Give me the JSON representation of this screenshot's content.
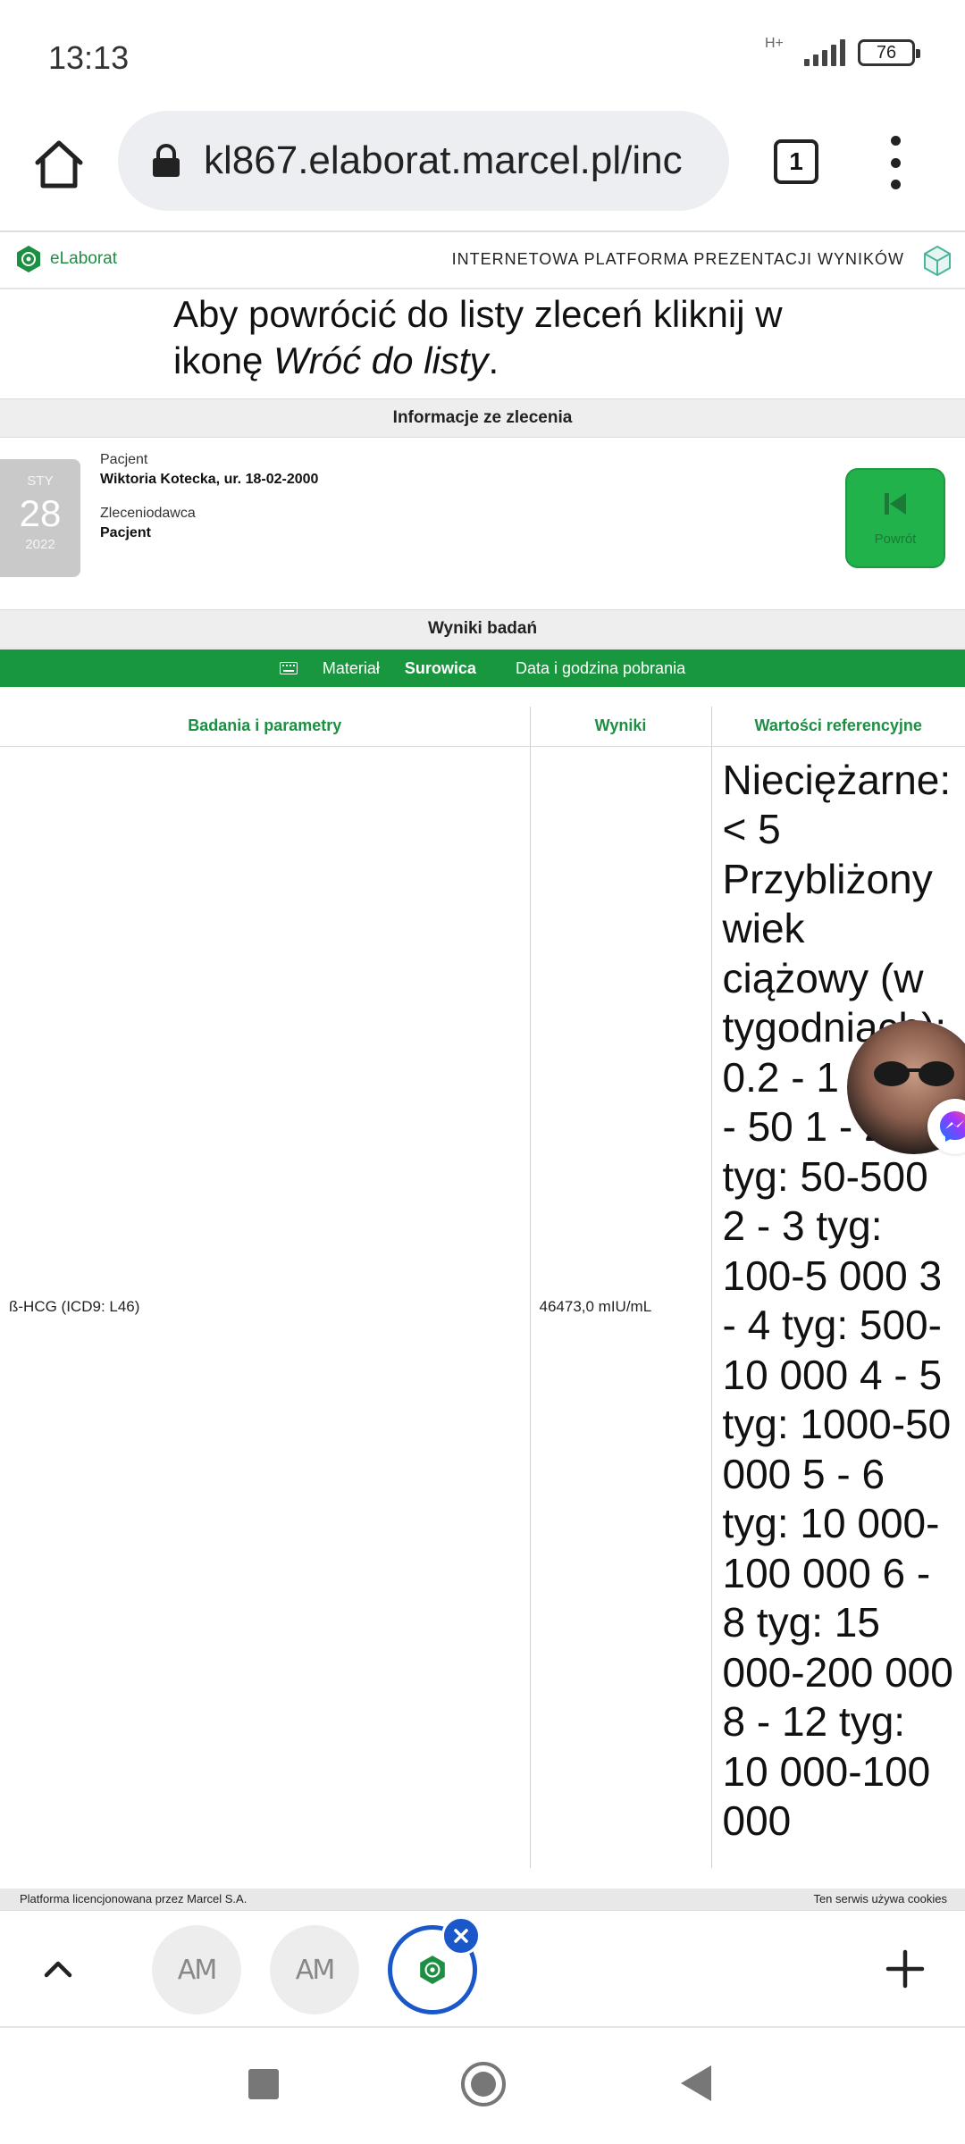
{
  "status_bar": {
    "time": "13:13",
    "network_type": "H+",
    "battery_level": "76"
  },
  "browser": {
    "url": "kl867.elaborat.marcel.pl/inc",
    "tab_count": "1"
  },
  "site_header": {
    "brand_name": "eLaborat",
    "platform_title": "INTERNETOWA PLATFORMA PREZENTACJI WYNIKÓW"
  },
  "instruction": {
    "text_before": "Aby powrócić do listy zleceń kliknij w ikonę ",
    "emphasis": "Wróć do listy",
    "text_after": "."
  },
  "order_info": {
    "section_title": "Informacje ze zlecenia",
    "date": {
      "month": "STY",
      "day": "28",
      "year": "2022"
    },
    "patient_label": "Pacjent",
    "patient_value": "Wiktoria Kotecka, ur. 18-02-2000",
    "orderer_label": "Zleceniodawca",
    "orderer_value": "Pacjent",
    "back_button_label": "Powrót"
  },
  "results": {
    "section_title": "Wyniki badań",
    "material_label": "Materiał",
    "material_value": "Surowica",
    "collection_label": "Data i godzina pobrania",
    "columns": [
      "Badania i parametry",
      "Wyniki",
      "Wartości referencyjne"
    ],
    "rows": [
      {
        "parameter": "ß-HCG (ICD9: L46)",
        "result": "46473,0 mIU/mL",
        "reference": "Nieciężarne: < 5 Przybliżony wiek ciążowy (w tygodniach): 0.2 - 1 tyg: 5 - 50 1 - 2 tyg: 50-500 2 - 3 tyg: 100-5 000 3 - 4 tyg: 500-10 000 4 - 5 tyg: 1000-50 000 5 - 6 tyg: 10 000-100 000 6 - 8 tyg: 15 000-200 000 8 - 12 tyg: 10 000-100 000"
      }
    ]
  },
  "footer": {
    "left": "Platforma licencjonowana przez Marcel S.A.",
    "right": "Ten serwis używa cookies"
  },
  "tab_strip": {
    "tab1_label": "AM",
    "tab2_label": "AM"
  },
  "colors": {
    "brand_green": "#18973f",
    "tab_active_blue": "#1a57c8"
  }
}
